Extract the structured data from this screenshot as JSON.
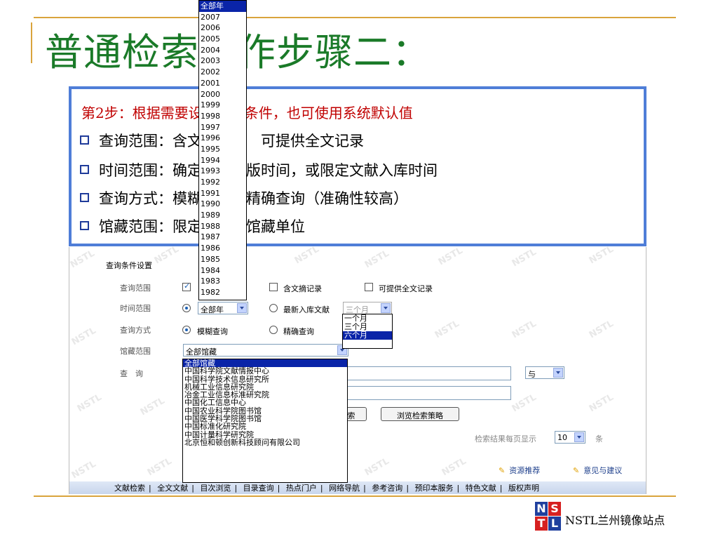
{
  "slide": {
    "title": "普通检索操作步骤二：",
    "step": "第2步：根据需要设置查询条件，也可使用系统默认值",
    "bullets": [
      "查询范围：含文摘记录　可提供全文记录",
      "时间范围：确定文献出版时间，或限定文献入库时间",
      "查询方式：模糊查询　精确查询（准确性较高）",
      "馆藏范围：限定文献的馆藏单位"
    ]
  },
  "form": {
    "section_title": "查询条件设置",
    "labels": {
      "scope": "查询范围",
      "time": "时间范围",
      "mode": "查询方式",
      "holdings": "馆藏范围",
      "query": "查　询"
    },
    "scope_options": {
      "abstract": "含文摘记录",
      "fulltext": "可提供全文记录"
    },
    "time": {
      "year_value": "全部年",
      "latest_label": "最新入库文献",
      "month_value": "三个月"
    },
    "mode_options": {
      "fuzzy": "模糊查询",
      "exact": "精确查询"
    },
    "holdings_value": "全部馆藏",
    "logic_value": "与",
    "buttons": {
      "search_partial": "索",
      "browse_strategy": "浏览检索策略"
    },
    "per_page_label": "检索结果每页显示",
    "per_page_value": "10",
    "per_page_unit": "条",
    "links": {
      "recommend": "资源推荐",
      "feedback": "意见与建议"
    }
  },
  "year_dropdown": [
    "全部年",
    "2007",
    "2006",
    "2005",
    "2004",
    "2003",
    "2002",
    "2001",
    "2000",
    "1999",
    "1998",
    "1997",
    "1996",
    "1995",
    "1994",
    "1993",
    "1992",
    "1991",
    "1990",
    "1989",
    "1988",
    "1987",
    "1986",
    "1985",
    "1984",
    "1983",
    "1982"
  ],
  "month_dropdown": [
    "一个月",
    "三个月",
    "六个月"
  ],
  "library_dropdown": [
    "全部馆藏",
    "中国科学院文献情报中心",
    "中国科学技术信息研究所",
    "机械工业信息研究院",
    "冶金工业信息标准研究院",
    "中国化工信息中心",
    "中国农业科学院图书馆",
    "中国医学科学院图书馆",
    "中国标准化研究院",
    "中国计量科学研究院",
    "北京恒和顿创新科技顾问有限公司"
  ],
  "navbar": [
    "文献检索",
    "全文文献",
    "目次浏览",
    "目录查询",
    "热点门户",
    "网络导航",
    "参考咨询",
    "预印本服务",
    "特色文献",
    "版权声明"
  ],
  "footer": {
    "logo_letters": [
      "N",
      "S",
      "T",
      "L"
    ],
    "station": "NSTL兰州镜像站点"
  },
  "watermark": "NSTL",
  "colors": {
    "title_green": "#1a7a28",
    "step_red": "#c00000",
    "callout_border": "#4f7ed8",
    "gold_rule": "#d9a43c",
    "selection_blue": "#0a24a8"
  }
}
